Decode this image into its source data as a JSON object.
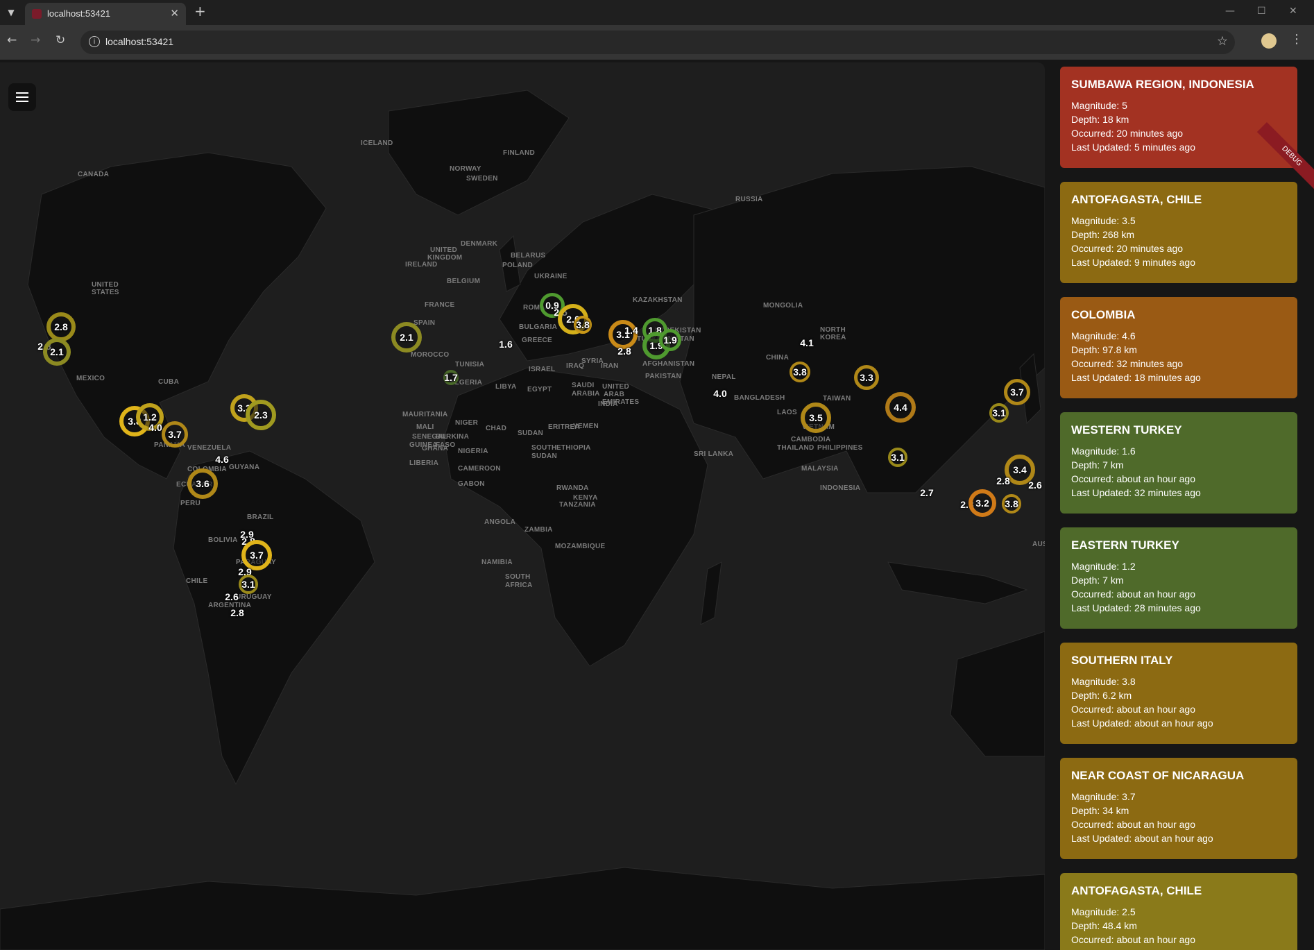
{
  "browser": {
    "tab_title": "localhost:53421",
    "url": "localhost:53421",
    "icons": [
      "tab-list-icon",
      "close-icon",
      "plus-icon",
      "back-icon",
      "forward-icon",
      "reload-icon",
      "site-info-icon",
      "star-icon",
      "profile-icon",
      "kebab-icon",
      "minimize-icon",
      "maximize-icon",
      "window-close-icon"
    ]
  },
  "map": {
    "countries": [
      {
        "label": "CANADA"
      },
      {
        "label": "UNITED"
      },
      {
        "label": "STATES"
      },
      {
        "label": "MEXICO"
      },
      {
        "label": "CUBA"
      },
      {
        "label": "PANAMA"
      },
      {
        "label": "VENEZUELA"
      },
      {
        "label": "GUYANA"
      },
      {
        "label": "COLOMBIA"
      },
      {
        "label": "PERU"
      },
      {
        "label": "BRAZIL"
      },
      {
        "label": "BOLIVIA"
      },
      {
        "label": "PARAGUAY"
      },
      {
        "label": "URUGUAY"
      },
      {
        "label": "ARGENTINA"
      },
      {
        "label": "ICELAND"
      },
      {
        "label": "NORWAY"
      },
      {
        "label": "SWEDEN"
      },
      {
        "label": "FINLAND"
      },
      {
        "label": "UNITED"
      },
      {
        "label": "KINGDOM"
      },
      {
        "label": "IRELAND"
      },
      {
        "label": "DENMARK"
      },
      {
        "label": "POLAND"
      },
      {
        "label": "BELARUS"
      },
      {
        "label": "BELGIUM"
      },
      {
        "label": "UKRAINE"
      },
      {
        "label": "FRANCE"
      },
      {
        "label": "ROMANIA"
      },
      {
        "label": "SPAIN"
      },
      {
        "label": "MOROCCO"
      },
      {
        "label": "TUNISIA"
      },
      {
        "label": "ALGERIA"
      },
      {
        "label": "LIBYA"
      },
      {
        "label": "EGYPT"
      },
      {
        "label": "MAURITANIA"
      },
      {
        "label": "MALI"
      },
      {
        "label": "NIGER"
      },
      {
        "label": "CHAD"
      },
      {
        "label": "SUDAN"
      },
      {
        "label": "SENEGAL"
      },
      {
        "label": "GUINEA"
      },
      {
        "label": "BURKINA"
      },
      {
        "label": "FASO"
      },
      {
        "label": "GHANA"
      },
      {
        "label": "NIGERIA"
      },
      {
        "label": "LIBERIA"
      },
      {
        "label": "CAMEROON"
      },
      {
        "label": "GABON"
      },
      {
        "label": "ERITREA"
      },
      {
        "label": "YEMEN"
      },
      {
        "label": "SOUTH"
      },
      {
        "label": "SUDAN"
      },
      {
        "label": "ETHIOPIA"
      },
      {
        "label": "KENYA"
      },
      {
        "label": "RWANDA"
      },
      {
        "label": "TANZANIA"
      },
      {
        "label": "ANGOLA"
      },
      {
        "label": "ZAMBIA"
      },
      {
        "label": "NAMIBIA"
      },
      {
        "label": "MOZAMBIQUE"
      },
      {
        "label": "SOUTH"
      },
      {
        "label": "AFRICA"
      },
      {
        "label": "SAUDI"
      },
      {
        "label": "ARABIA"
      },
      {
        "label": "UNITED"
      },
      {
        "label": "ARAB"
      },
      {
        "label": "EMIRATES"
      },
      {
        "label": "ISRAEL"
      },
      {
        "label": "SYRIA"
      },
      {
        "label": "IRAQ"
      },
      {
        "label": "IRAN"
      },
      {
        "label": "AFGHANISTAN"
      },
      {
        "label": "PAKISTAN"
      },
      {
        "label": "INDIA"
      },
      {
        "label": "KAZAKHSTAN"
      },
      {
        "label": "UZBEKISTAN"
      },
      {
        "label": "TURKMENISTAN"
      },
      {
        "label": "RUSSIA"
      },
      {
        "label": "MONGOLIA"
      },
      {
        "label": "CHINA"
      },
      {
        "label": "NORTH"
      },
      {
        "label": "KOREA"
      },
      {
        "label": "BANGLADESH"
      },
      {
        "label": "LAOS"
      },
      {
        "label": "VIETNAM"
      },
      {
        "label": "CAMBODIA"
      },
      {
        "label": "THAILAND"
      },
      {
        "label": "MALAYSIA"
      },
      {
        "label": "SRI LANKA"
      },
      {
        "label": "PHILIPPINES"
      },
      {
        "label": "TAIWAN"
      },
      {
        "label": "INDONESIA"
      },
      {
        "label": "AUS"
      },
      {
        "label": "BULGARIA"
      },
      {
        "label": "GREECE"
      },
      {
        "label": "NEPAL"
      },
      {
        "label": "ECUADOR"
      },
      {
        "label": "CHILE"
      }
    ],
    "markers": [
      {
        "mag": "2.8",
        "color": "#9a8a1a"
      },
      {
        "mag": "2.8",
        "color": "#9a8a1a"
      },
      {
        "mag": "2.1",
        "color": "#8c8a22"
      },
      {
        "mag": "2.1",
        "color": "#8c8a22"
      },
      {
        "mag": "1.6",
        "color": "#6a8a2a"
      },
      {
        "mag": "1.7",
        "color": "#4a6a2a"
      },
      {
        "mag": "0.9",
        "color": "#4f9a2f"
      },
      {
        "mag": "2.5",
        "color": "#c0a21c"
      },
      {
        "mag": "2.0",
        "color": "#d4b01a"
      },
      {
        "mag": "3.8",
        "color": "#c99818"
      },
      {
        "mag": "3.1",
        "color": "#c98a18"
      },
      {
        "mag": "1.4",
        "color": "#8aa220"
      },
      {
        "mag": "1.8",
        "color": "#4f9a2f"
      },
      {
        "mag": "1.9",
        "color": "#4f9a2f"
      },
      {
        "mag": "1.9",
        "color": "#4f9a2f"
      },
      {
        "mag": "2.8",
        "color": "#9a8a1a"
      },
      {
        "mag": "4.1",
        "color": "#b07a18"
      },
      {
        "mag": "3.8",
        "color": "#b08818"
      },
      {
        "mag": "4.0",
        "color": "#b07a18"
      },
      {
        "mag": "3.3",
        "color": "#b08818"
      },
      {
        "mag": "4.4",
        "color": "#b07a18"
      },
      {
        "mag": "3.7",
        "color": "#b08818"
      },
      {
        "mag": "3.1",
        "color": "#9a8a1a"
      },
      {
        "mag": "3.1",
        "color": "#9a8a1a"
      },
      {
        "mag": "3.4",
        "color": "#b08818"
      },
      {
        "mag": "2.8",
        "color": "#9a8a1a"
      },
      {
        "mag": "2.6",
        "color": "#9a8a1a"
      },
      {
        "mag": "2.7",
        "color": "#9a8a1a"
      },
      {
        "mag": "2.8",
        "color": "#9a8a1a"
      },
      {
        "mag": "3.2",
        "color": "#d07a18"
      },
      {
        "mag": "3.8",
        "color": "#b08818"
      },
      {
        "mag": "3.5",
        "color": "#b08818"
      },
      {
        "mag": "3.8",
        "color": "#e0b41a"
      },
      {
        "mag": "1.2",
        "color": "#c0a21c"
      },
      {
        "mag": "4.0",
        "color": "#b07a18"
      },
      {
        "mag": "3.7",
        "color": "#b08818"
      },
      {
        "mag": "3.3",
        "color": "#c0a21c"
      },
      {
        "mag": "2.3",
        "color": "#a09a20"
      },
      {
        "mag": "4.6",
        "color": "#b07a18"
      },
      {
        "mag": "3.6",
        "color": "#b08818"
      },
      {
        "mag": "2.9",
        "color": "#9a8a1a"
      },
      {
        "mag": "2.8",
        "color": "#9a8a1a"
      },
      {
        "mag": "3.7",
        "color": "#e0b41a"
      },
      {
        "mag": "2.9",
        "color": "#9a8a1a"
      },
      {
        "mag": "3.1",
        "color": "#9a8a1a"
      },
      {
        "mag": "2.6",
        "color": "#9a8a1a"
      },
      {
        "mag": "2.8",
        "color": "#9a8a1a"
      }
    ]
  },
  "sidebar": {
    "cards": [
      {
        "title": "SUMBAWA REGION, INDONESIA",
        "magnitude": "Magnitude: 5",
        "depth": "Depth: 18 km",
        "occurred": "Occurred: 20 minutes ago",
        "updated": "Last Updated: 5 minutes ago",
        "color": "#a33222"
      },
      {
        "title": "ANTOFAGASTA, CHILE",
        "magnitude": "Magnitude: 3.5",
        "depth": "Depth: 268 km",
        "occurred": "Occurred: 20 minutes ago",
        "updated": "Last Updated: 9 minutes ago",
        "color": "#8c6a12"
      },
      {
        "title": "COLOMBIA",
        "magnitude": "Magnitude: 4.6",
        "depth": "Depth: 97.8 km",
        "occurred": "Occurred: 32 minutes ago",
        "updated": "Last Updated: 18 minutes ago",
        "color": "#9a5a14"
      },
      {
        "title": "WESTERN TURKEY",
        "magnitude": "Magnitude: 1.6",
        "depth": "Depth: 7 km",
        "occurred": "Occurred: about an hour ago",
        "updated": "Last Updated: 32 minutes ago",
        "color": "#4f6a2a"
      },
      {
        "title": "EASTERN TURKEY",
        "magnitude": "Magnitude: 1.2",
        "depth": "Depth: 7 km",
        "occurred": "Occurred: about an hour ago",
        "updated": "Last Updated: 28 minutes ago",
        "color": "#4f6a2a"
      },
      {
        "title": "SOUTHERN ITALY",
        "magnitude": "Magnitude: 3.8",
        "depth": "Depth: 6.2 km",
        "occurred": "Occurred: about an hour ago",
        "updated": "Last Updated: about an hour ago",
        "color": "#8c6a12"
      },
      {
        "title": "NEAR COAST OF NICARAGUA",
        "magnitude": "Magnitude: 3.7",
        "depth": "Depth: 34 km",
        "occurred": "Occurred: about an hour ago",
        "updated": "Last Updated: about an hour ago",
        "color": "#8c6a12"
      },
      {
        "title": "ANTOFAGASTA, CHILE",
        "magnitude": "Magnitude: 2.5",
        "depth": "Depth: 48.4 km",
        "occurred": "Occurred: about an hour ago",
        "updated": "",
        "color": "#8a7a1a"
      }
    ]
  },
  "debug_banner": "DEBUG"
}
